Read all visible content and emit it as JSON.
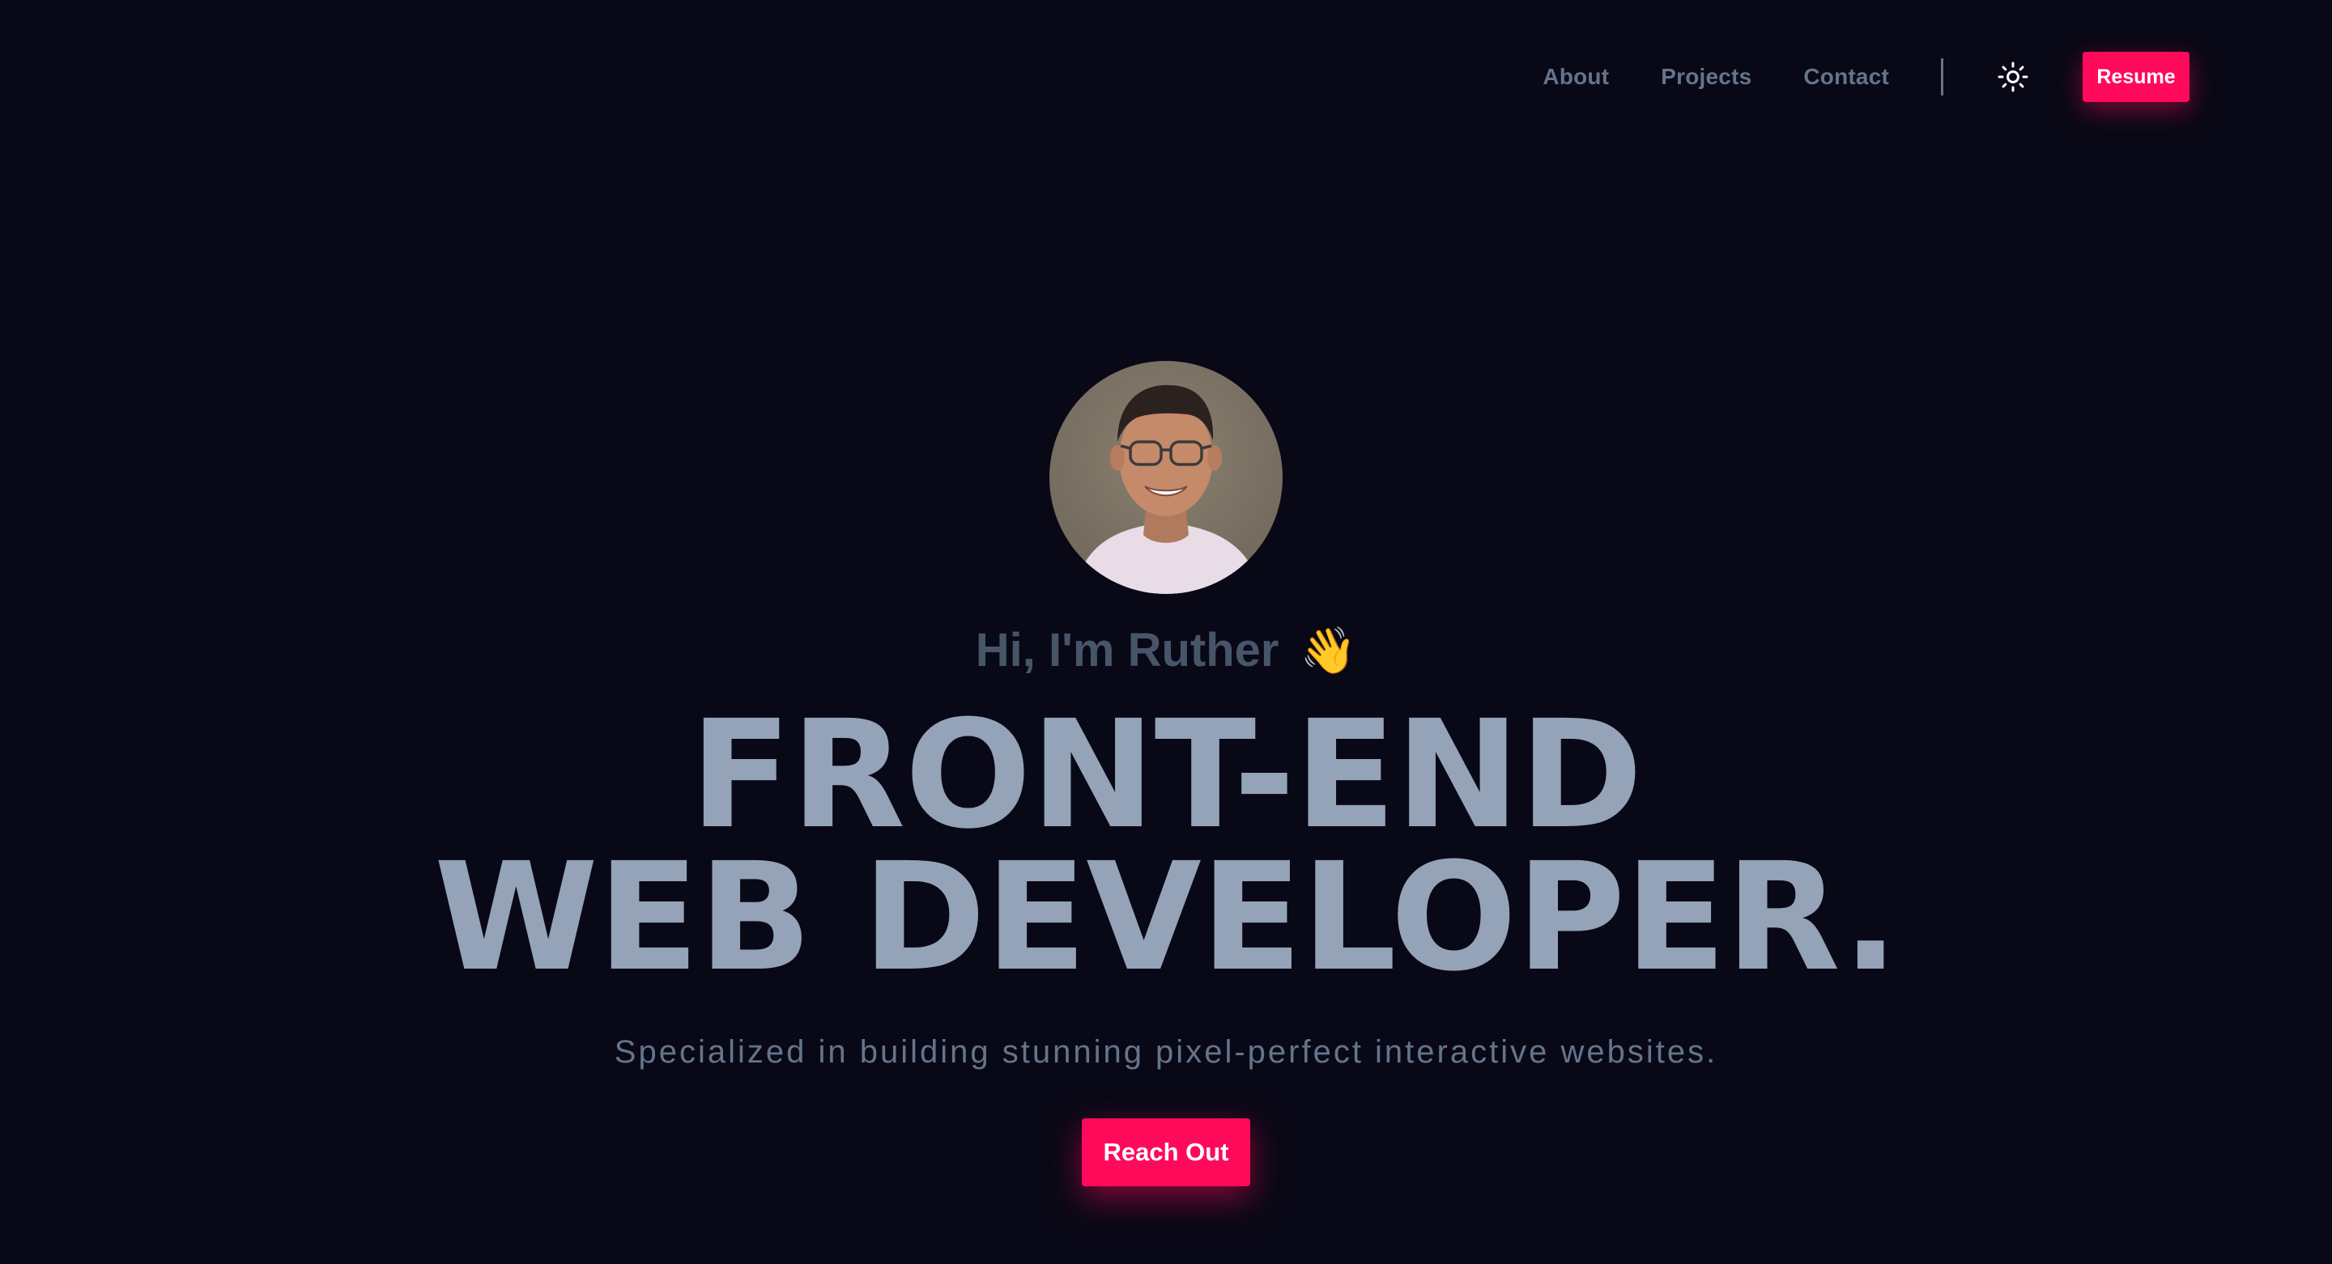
{
  "nav": {
    "items": [
      {
        "label": "About"
      },
      {
        "label": "Projects"
      },
      {
        "label": "Contact"
      }
    ],
    "theme_toggle_icon": "sun-icon",
    "resume_label": "Resume"
  },
  "hero": {
    "avatar_alt": "portrait-photo",
    "greeting": "Hi, I'm Ruther",
    "wave_emoji": "👋",
    "headline_line1": "FRONT-END",
    "headline_line2": "WEB DEVELOPER.",
    "tagline": "Specialized in building stunning pixel-perfect interactive websites.",
    "cta_label": "Reach Out"
  },
  "colors": {
    "background": "#090816",
    "accent": "#ff0a5b",
    "headline": "#94a3b8",
    "muted": "#64748b"
  }
}
